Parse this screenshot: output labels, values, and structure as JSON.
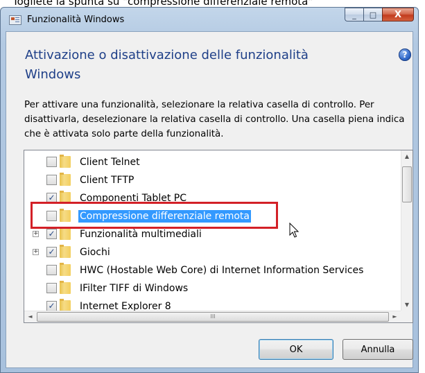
{
  "caption": "Togliete la spunta su \"compressione differenziale remota\"",
  "window": {
    "title": "Funzionalità Windows",
    "minimize_glyph": "_",
    "maximize_glyph": "□",
    "close_glyph": "X"
  },
  "header": {
    "heading": "Attivazione o disattivazione delle funzionalità Windows",
    "help_glyph": "?",
    "instructions": "Per attivare una funzionalità, selezionare la relativa casella di controllo. Per disattivarla, deselezionare la relativa casella di controllo. Una casella piena indica che è attivata solo parte della funzionalità."
  },
  "features": [
    {
      "label": "Client Telnet",
      "checked": false,
      "expandable": false,
      "selected": false
    },
    {
      "label": "Client TFTP",
      "checked": false,
      "expandable": false,
      "selected": false
    },
    {
      "label": "Componenti Tablet PC",
      "checked": true,
      "expandable": false,
      "selected": false
    },
    {
      "label": "Compressione differenziale remota",
      "checked": false,
      "expandable": false,
      "selected": true
    },
    {
      "label": "Funzionalità multimediali",
      "checked": true,
      "expandable": true,
      "selected": false
    },
    {
      "label": "Giochi",
      "checked": true,
      "expandable": true,
      "selected": false
    },
    {
      "label": "HWC (Hostable Web Core) di Internet Information Services",
      "checked": false,
      "expandable": false,
      "selected": false
    },
    {
      "label": "IFilter TIFF di Windows",
      "checked": false,
      "expandable": false,
      "selected": false
    },
    {
      "label": "Internet Explorer 8",
      "checked": true,
      "expandable": false,
      "selected": false
    }
  ],
  "scrollbar": {
    "up_glyph": "▲",
    "down_glyph": "▼",
    "left_glyph": "◄",
    "right_glyph": "►",
    "grip_glyph": "III"
  },
  "buttons": {
    "ok": "OK",
    "cancel": "Annulla"
  },
  "colors": {
    "heading": "#1e3f88",
    "selection": "#3399ff",
    "highlight_box": "#d32027"
  }
}
